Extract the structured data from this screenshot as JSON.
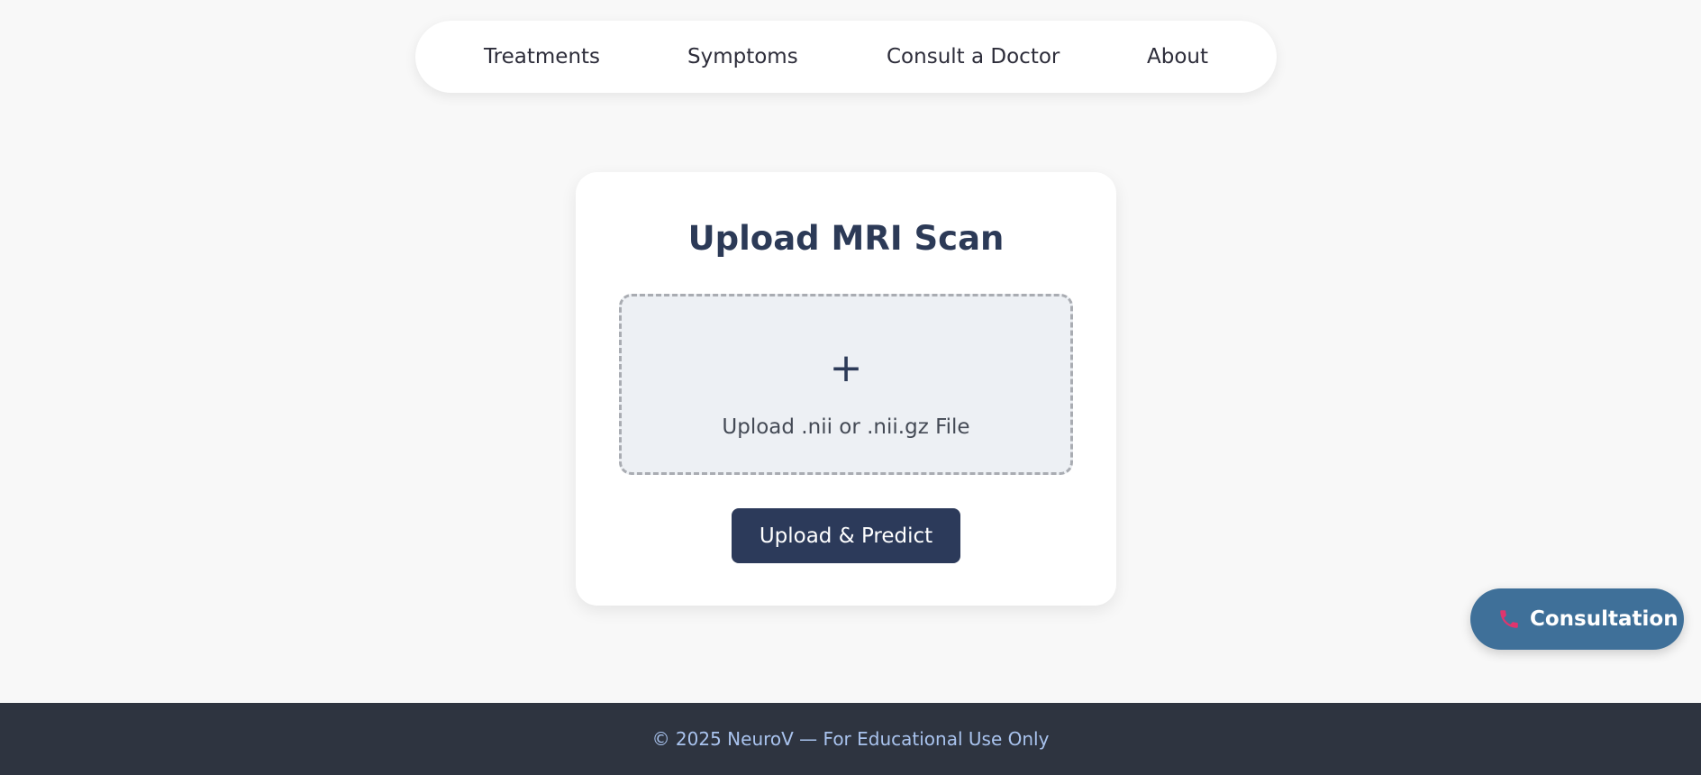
{
  "nav": {
    "items": [
      {
        "label": "Treatments"
      },
      {
        "label": "Symptoms"
      },
      {
        "label": "Consult a Doctor"
      },
      {
        "label": "About"
      }
    ]
  },
  "upload_card": {
    "title": "Upload MRI Scan",
    "dropzone": {
      "icon": "plus-icon",
      "icon_glyph": "+",
      "label": "Upload .nii or .nii.gz File"
    },
    "submit_label": "Upload & Predict"
  },
  "floating": {
    "consult_icon": "phone-icon",
    "consult_label": "Consultation"
  },
  "footer": {
    "text": "© 2025 NeuroV — For Educational Use Only"
  },
  "colors": {
    "background": "#f8f8f8",
    "primary_dark": "#2c3a5a",
    "consult_blue": "#3f7099",
    "phone_pink": "#e0356e",
    "footer_bg": "#2e3440",
    "footer_text": "#a9c3ee"
  }
}
